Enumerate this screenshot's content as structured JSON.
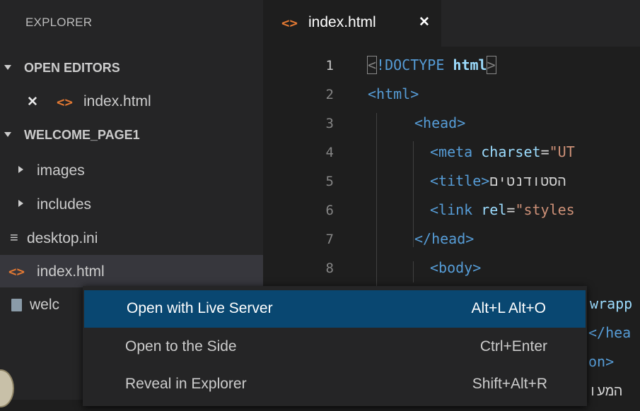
{
  "sidebar": {
    "header": "EXPLORER",
    "sections": {
      "open_editors": "OPEN EDITORS",
      "workspace": "WELCOME_PAGE1"
    },
    "open_editor_file": "index.html",
    "files": {
      "images": "images",
      "includes": "includes",
      "desktop": "desktop.ini",
      "index": "index.html",
      "welcome": "welc"
    }
  },
  "editor": {
    "tab_label": "index.html",
    "line_numbers": [
      "1",
      "2",
      "3",
      "4",
      "5",
      "6",
      "7",
      "8"
    ],
    "code": {
      "l1": {
        "open": "<",
        "kw": "!DOCTYPE",
        "name": "html",
        "close": ">"
      },
      "l2": {
        "tag": "<html>"
      },
      "l3": {
        "tag": "<head>"
      },
      "l4": {
        "tag": "<meta",
        "attr": "charset",
        "eq": "=",
        "str": "\"UT"
      },
      "l5": {
        "tag": "<title>",
        "text": "הסטודנטים"
      },
      "l6": {
        "tag": "<link",
        "attr": "rel",
        "eq": "=",
        "str": "\"styles"
      },
      "l7": {
        "tag": "</head>"
      },
      "l8": {
        "tag": "<body>"
      }
    },
    "peek_fragments": {
      "f1": "wrapp",
      "f2": "</hea",
      "f3": "on>",
      "f4": "המעו"
    }
  },
  "context_menu": {
    "items": [
      {
        "label": "Open with Live Server",
        "shortcut": "Alt+L Alt+O"
      },
      {
        "label": "Open to the Side",
        "shortcut": "Ctrl+Enter"
      },
      {
        "label": "Reveal in Explorer",
        "shortcut": "Shift+Alt+R"
      }
    ]
  },
  "icons": {
    "html_file": "html-file-icon",
    "close": "close-icon",
    "text_file": "text-file-icon",
    "image_file": "image-file-icon"
  },
  "colors": {
    "sidebar_bg": "#252526",
    "editor_bg": "#1e1e1e",
    "menu_highlight": "#094771",
    "html_icon": "#e37933",
    "tag_blue": "#569cd6",
    "attr_blue": "#9cdcfe",
    "string": "#ce9178"
  }
}
